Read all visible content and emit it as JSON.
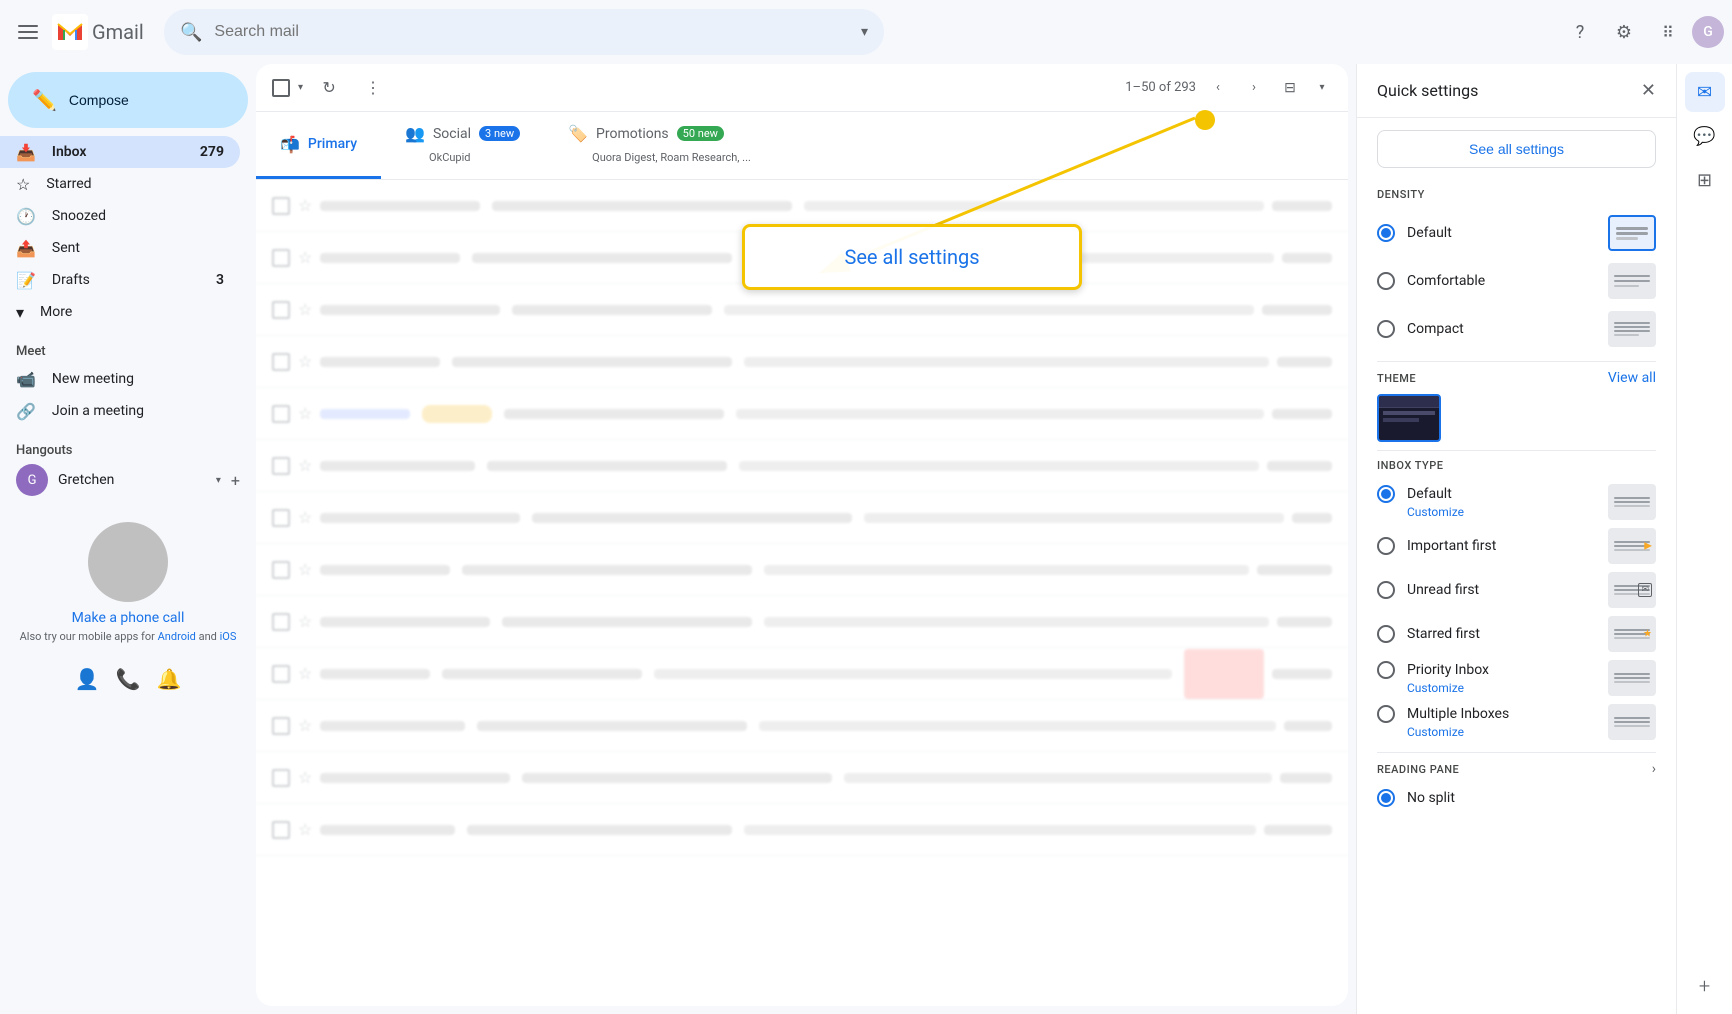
{
  "app": {
    "title": "Gmail",
    "logo_text": "Gmail"
  },
  "topbar": {
    "search_placeholder": "Search mail",
    "help_icon": "help-icon",
    "settings_icon": "settings-icon",
    "apps_icon": "apps-icon",
    "avatar_initials": "G"
  },
  "compose": {
    "label": "Compose",
    "icon": "pencil-icon"
  },
  "sidebar": {
    "nav_items": [
      {
        "id": "inbox",
        "label": "Inbox",
        "count": "279",
        "icon": "📥",
        "active": true
      },
      {
        "id": "starred",
        "label": "Starred",
        "count": "",
        "icon": "☆",
        "active": false
      },
      {
        "id": "snoozed",
        "label": "Snoozed",
        "count": "",
        "icon": "🕐",
        "active": false
      },
      {
        "id": "sent",
        "label": "Sent",
        "count": "",
        "icon": "📤",
        "active": false
      },
      {
        "id": "drafts",
        "label": "Drafts",
        "count": "3",
        "icon": "📝",
        "active": false
      },
      {
        "id": "more",
        "label": "More",
        "count": "",
        "icon": "▾",
        "active": false
      }
    ],
    "meet_section": "Meet",
    "meet_items": [
      {
        "id": "new-meeting",
        "label": "New meeting",
        "icon": "📹"
      },
      {
        "id": "join-meeting",
        "label": "Join a meeting",
        "icon": "🔗"
      }
    ],
    "hangouts_section": "Hangouts",
    "hangout_user": "Gretchen",
    "phone_link": "Make a phone call",
    "phone_sub1": "Also try our mobile apps for",
    "phone_android": "Android",
    "phone_and": "and",
    "phone_ios": "iOS"
  },
  "email_list": {
    "pagination": "1–50 of 293",
    "tabs": [
      {
        "id": "primary",
        "label": "Primary",
        "badge": "",
        "active": true
      },
      {
        "id": "social",
        "label": "Social",
        "badge": "3 new",
        "badge_color": "blue",
        "sub": "OkCupid",
        "active": false
      },
      {
        "id": "promotions",
        "label": "Promotions",
        "badge": "50 new",
        "badge_color": "red",
        "sub": "Quora Digest, Roam Research, ...",
        "active": false
      }
    ]
  },
  "quick_settings": {
    "title": "Quick settings",
    "see_all_label": "See all settings",
    "density_label": "DENSITY",
    "density_options": [
      {
        "id": "default",
        "label": "Default",
        "selected": true
      },
      {
        "id": "comfortable",
        "label": "Comfortable",
        "selected": false
      },
      {
        "id": "compact",
        "label": "Compact",
        "selected": false
      }
    ],
    "theme_label": "THEME",
    "theme_view_all": "View all",
    "inbox_type_label": "INBOX TYPE",
    "inbox_options": [
      {
        "id": "default-inbox",
        "label": "Default",
        "customize": "Customize",
        "selected": true
      },
      {
        "id": "important-first",
        "label": "Important first",
        "customize": "",
        "selected": false
      },
      {
        "id": "unread-first",
        "label": "Unread first",
        "customize": "",
        "selected": false
      },
      {
        "id": "starred-first",
        "label": "Starred first",
        "customize": "",
        "selected": false
      },
      {
        "id": "priority-inbox",
        "label": "Priority Inbox",
        "customize": "Customize",
        "selected": false
      },
      {
        "id": "multiple-inboxes",
        "label": "Multiple Inboxes",
        "customize": "Customize",
        "selected": false
      }
    ],
    "reading_pane_label": "READING PANE",
    "reading_pane_options": [
      {
        "id": "no-split",
        "label": "No split",
        "selected": true
      }
    ]
  },
  "highlight_box": {
    "text": "See all settings"
  },
  "colors": {
    "accent_blue": "#1a73e8",
    "gmail_red": "#ea4335",
    "active_nav_bg": "#d3e3fd",
    "highlight_yellow": "#f4c400"
  }
}
